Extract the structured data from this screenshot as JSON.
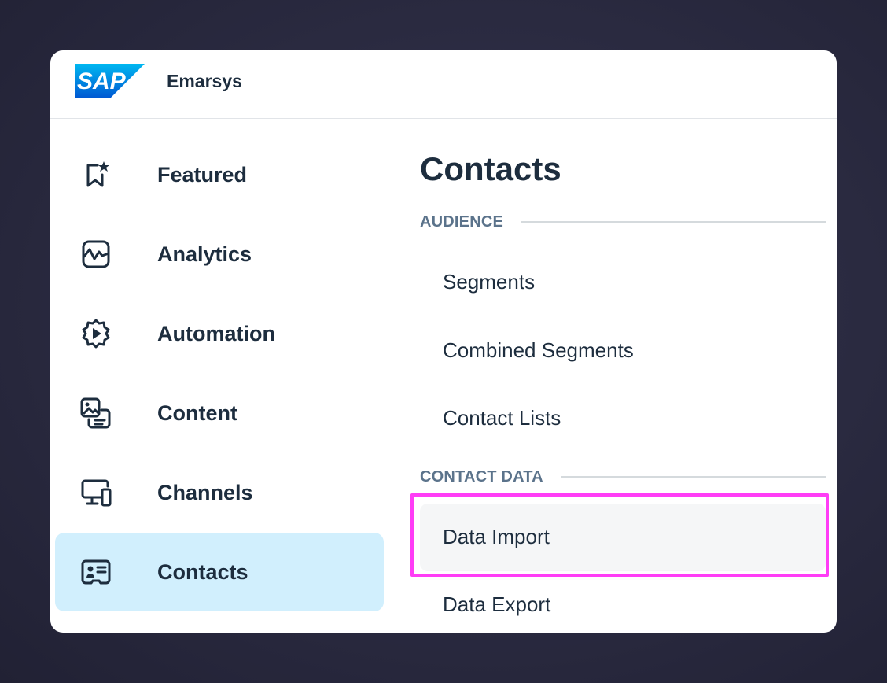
{
  "header": {
    "logo_text": "SAP",
    "app_name": "Emarsys"
  },
  "colors": {
    "brand_blue": "#0a6ed1",
    "active_nav_bg": "#d1effd",
    "highlight": "#ff3df6",
    "text": "#1d2d3e",
    "group_label": "#5b738b"
  },
  "nav": {
    "items": [
      {
        "label": "Featured",
        "icon": "bookmark-star-icon"
      },
      {
        "label": "Analytics",
        "icon": "analytics-icon"
      },
      {
        "label": "Automation",
        "icon": "automation-gear-icon"
      },
      {
        "label": "Content",
        "icon": "content-image-icon"
      },
      {
        "label": "Channels",
        "icon": "channels-devices-icon"
      },
      {
        "label": "Contacts",
        "icon": "contacts-card-icon",
        "active": true
      }
    ]
  },
  "main": {
    "title": "Contacts",
    "groups": [
      {
        "label": "AUDIENCE",
        "items": [
          "Segments",
          "Combined Segments",
          "Contact Lists"
        ]
      },
      {
        "label": "CONTACT DATA",
        "items": [
          "Data Import",
          "Data Export"
        ]
      }
    ],
    "highlighted_item": "Data Import"
  }
}
